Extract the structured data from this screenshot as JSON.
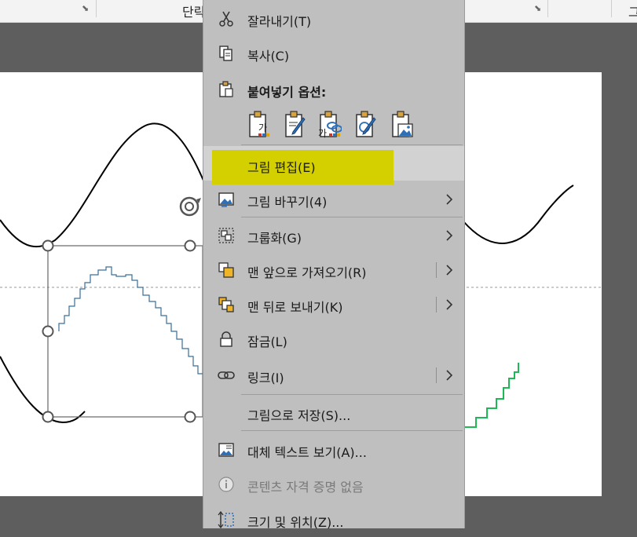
{
  "ribbon": {
    "group_label_left": "단락",
    "group_label_right": "그"
  },
  "context_menu": {
    "items": [
      {
        "id": "cut",
        "label": "잘라내기(T)",
        "icon": "scissors-icon"
      },
      {
        "id": "copy",
        "label": "복사(C)",
        "icon": "copy-icon"
      },
      {
        "id": "paste_options",
        "label": "붙여넣기 옵션:",
        "icon": "clipboard-icon"
      },
      {
        "id": "edit_picture",
        "label": "그림 편집(E)",
        "highlighted": true
      },
      {
        "id": "change_picture",
        "label": "그림 바꾸기(4)",
        "icon": "change-picture-icon",
        "submenu": true
      },
      {
        "id": "group",
        "label": "그룹화(G)",
        "icon": "group-icon",
        "submenu": true
      },
      {
        "id": "bring_front",
        "label": "맨 앞으로 가져오기(R)",
        "icon": "bring-front-icon",
        "submenu": true,
        "split": true
      },
      {
        "id": "send_back",
        "label": "맨 뒤로 보내기(K)",
        "icon": "send-back-icon",
        "submenu": true,
        "split": true
      },
      {
        "id": "lock",
        "label": "잠금(L)",
        "icon": "lock-icon"
      },
      {
        "id": "link",
        "label": "링크(I)",
        "icon": "link-icon",
        "submenu": true,
        "split": true
      },
      {
        "id": "save_as_picture",
        "label": "그림으로 저장(S)..."
      },
      {
        "id": "alt_text",
        "label": "대체 텍스트 보기(A)...",
        "icon": "alt-text-icon"
      },
      {
        "id": "no_credentials",
        "label": "콘텐츠 자격 증명 없음",
        "icon": "info-icon",
        "disabled": true
      },
      {
        "id": "size_position",
        "label": "크기 및 위치(Z)...",
        "icon": "size-position-icon"
      }
    ],
    "paste_buttons": [
      {
        "icon": "paste-keep-source-formatting-icon",
        "glyph": "가"
      },
      {
        "icon": "paste-merge-formatting-icon",
        "glyph": ""
      },
      {
        "icon": "paste-link-icon",
        "glyph": "가"
      },
      {
        "icon": "paste-use-destination-theme-icon",
        "glyph": ""
      },
      {
        "icon": "paste-as-picture-icon",
        "glyph": ""
      }
    ]
  },
  "colors": {
    "menu_bg": "#bfbfbf",
    "highlight_mark": "#d4d000",
    "step_line_blue": "#3a6f9a",
    "step_line_green": "#1db954",
    "wave_black": "#000000"
  }
}
